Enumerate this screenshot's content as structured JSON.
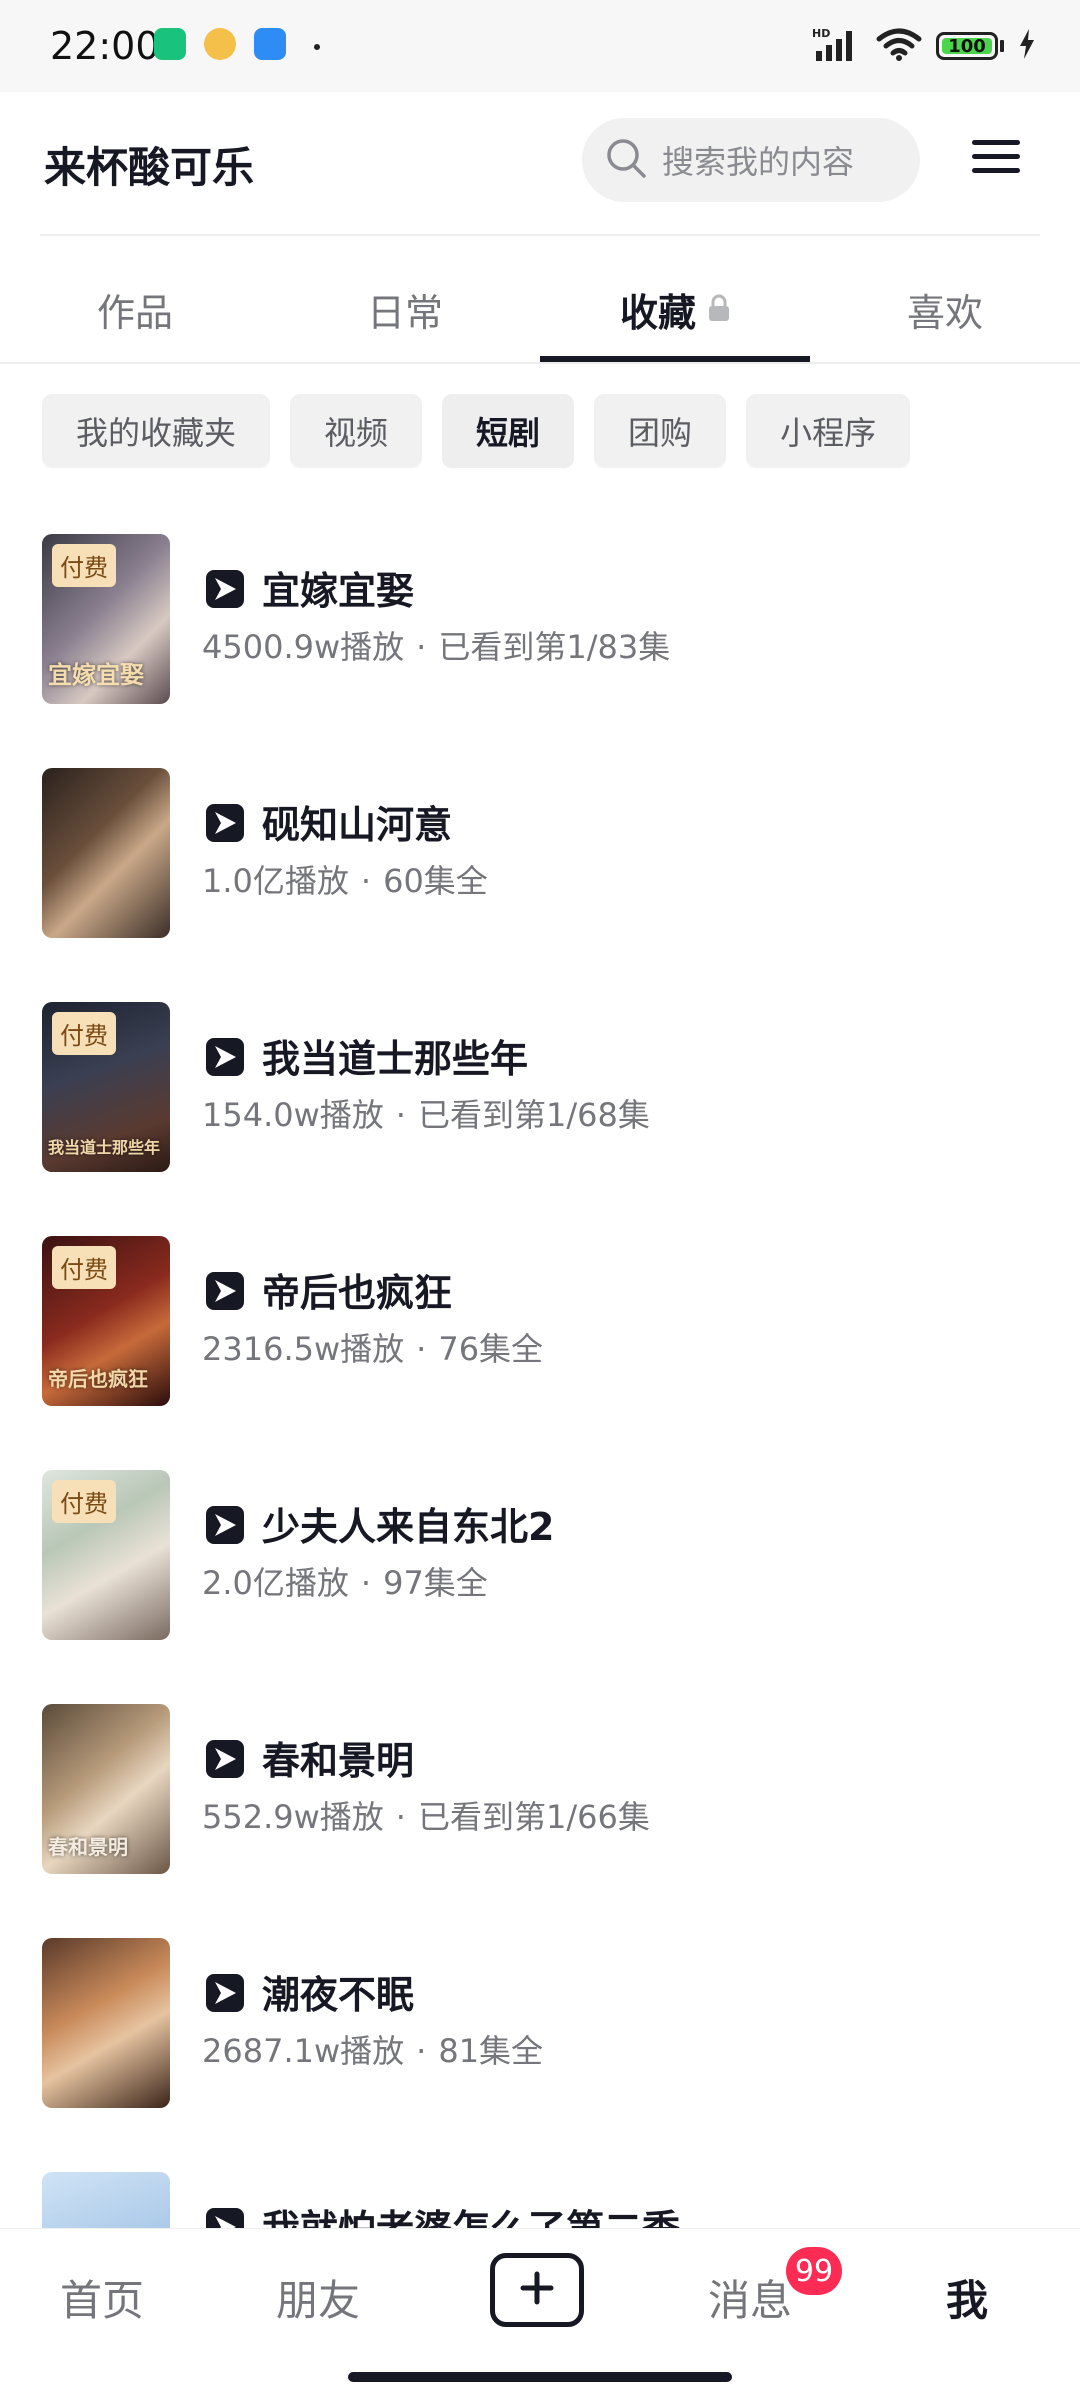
{
  "status_bar": {
    "time": "22:00",
    "battery": "100",
    "network": "HD"
  },
  "header": {
    "username": "来杯酸可乐",
    "search_placeholder": "搜索我的内容"
  },
  "tabs": [
    {
      "label": "作品"
    },
    {
      "label": "日常"
    },
    {
      "label": "收藏"
    },
    {
      "label": "喜欢"
    }
  ],
  "filters": [
    {
      "label": "我的收藏夹"
    },
    {
      "label": "视频"
    },
    {
      "label": "短剧"
    },
    {
      "label": "团购"
    },
    {
      "label": "小程序"
    }
  ],
  "dramas": [
    {
      "title": "宜嫁宜娶",
      "plays": "4500.9w播放",
      "status": "已看到第1/83集",
      "badge": "付费",
      "cover_text": "宜嫁宜娶"
    },
    {
      "title": "砚知山河意",
      "plays": "1.0亿播放",
      "status": "60集全",
      "badge": "",
      "cover_text": ""
    },
    {
      "title": "我当道士那些年",
      "plays": "154.0w播放",
      "status": "已看到第1/68集",
      "badge": "付费",
      "cover_text": "我当道士那些年"
    },
    {
      "title": "帝后也疯狂",
      "plays": "2316.5w播放",
      "status": "76集全",
      "badge": "付费",
      "cover_text": "帝后也疯狂"
    },
    {
      "title": "少夫人来自东北2",
      "plays": "2.0亿播放",
      "status": "97集全",
      "badge": "付费",
      "cover_text": ""
    },
    {
      "title": "春和景明",
      "plays": "552.9w播放",
      "status": "已看到第1/66集",
      "badge": "",
      "cover_text": "春和景明"
    },
    {
      "title": "潮夜不眠",
      "plays": "2687.1w播放",
      "status": "81集全",
      "badge": "",
      "cover_text": ""
    },
    {
      "title": "我就怕老婆怎么了第二季",
      "plays": "",
      "status": "",
      "badge": "",
      "cover_text": ""
    }
  ],
  "meta_separator": "·",
  "bottom_nav": {
    "home": "首页",
    "friends": "朋友",
    "messages": "消息",
    "messages_badge": "99",
    "me": "我"
  },
  "colors": {
    "accent": "#161823",
    "badge_red": "#fe2c55",
    "paid_badge_bg": "#f7dfb7",
    "chip_bg": "#f1f1f2",
    "meta_text": "#75767c"
  },
  "icons": {
    "search": "search-icon",
    "menu": "menu-icon",
    "lock": "lock-icon",
    "play": "play-icon",
    "add": "add-icon"
  }
}
